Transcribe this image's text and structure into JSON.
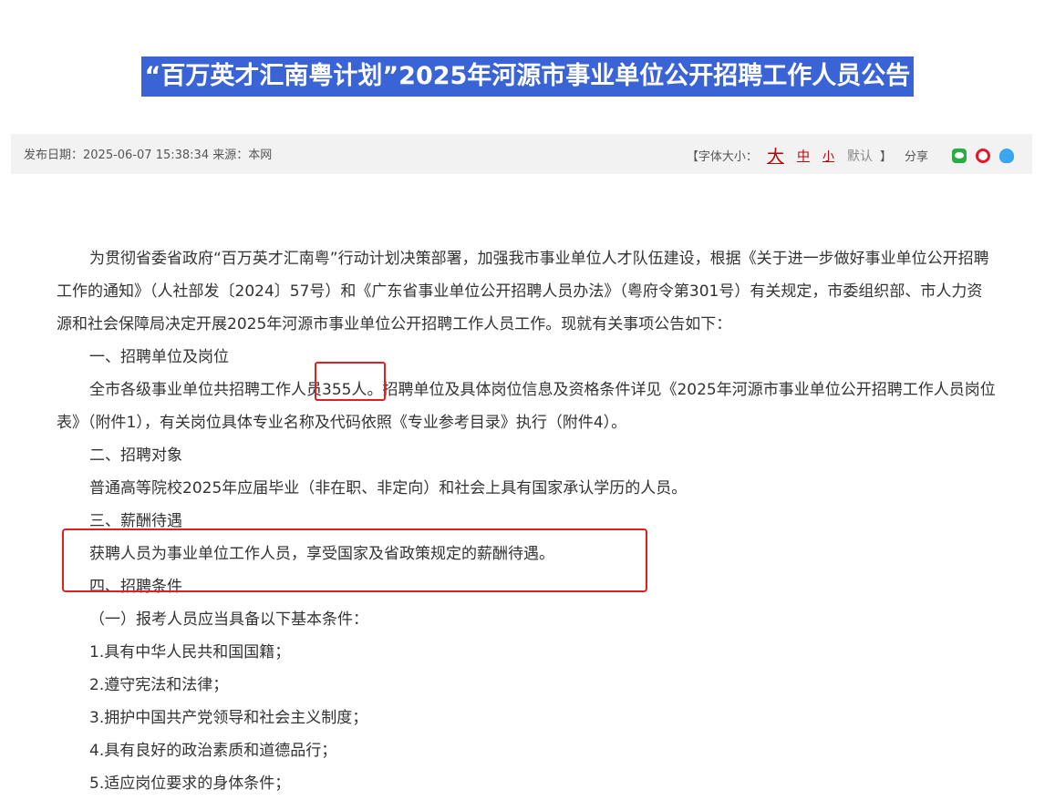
{
  "article": {
    "title": "“百万英才汇南粤计划”2025年河源市事业单位公开招聘工作人员公告",
    "meta": {
      "publish_label": "发布日期：",
      "publish_datetime": "2025-06-07 15:38:34",
      "source_label": "来源：",
      "source": "本网",
      "font_size_label": "【字体大小：",
      "font_big": "大",
      "font_mid": "中",
      "font_small": "小",
      "font_default": "默认",
      "font_close": "】",
      "share_label": "分享"
    },
    "paragraphs": [
      "为贯彻省委省政府“百万英才汇南粤”行动计划决策部署，加强我市事业单位人才队伍建设，根据《关于进一步做好事业单位公开招聘工作的通知》（人社部发〔2024〕57号）和《广东省事业单位公开招聘人员办法》（粤府令第301号）有关规定，市委组织部、市人力资源和社会保障局决定开展2025年河源市事业单位公开招聘工作人员工作。现就有关事项公告如下：",
      "一、招聘单位及岗位",
      "全市各级事业单位共招聘工作人员355人。招聘单位及具体岗位信息及资格条件详见《2025年河源市事业单位公开招聘工作人员岗位表》（附件1），有关岗位具体专业名称及代码依照《专业参考目录》执行（附件4）。",
      "二、招聘对象",
      "普通高等院校2025年应届毕业（非在职、非定向）和社会上具有国家承认学历的人员。",
      "三、薪酬待遇",
      "获聘人员为事业单位工作人员，享受国家及省政策规定的薪酬待遇。",
      "四、招聘条件",
      "（一）报考人员应当具备以下基本条件：",
      "1.具有中华人民共和国国籍；",
      "2.遵守宪法和法律；",
      "3.拥护中国共产党领导和社会主义制度；",
      "4.具有良好的政治素质和道德品行；",
      "5.适应岗位要求的身体条件；"
    ]
  },
  "colors": {
    "title_bg": "#3a63d6",
    "highlight": "#e02020",
    "font_link": "#c00000"
  },
  "icons": [
    "wechat-icon",
    "weibo-icon",
    "qq-icon"
  ]
}
